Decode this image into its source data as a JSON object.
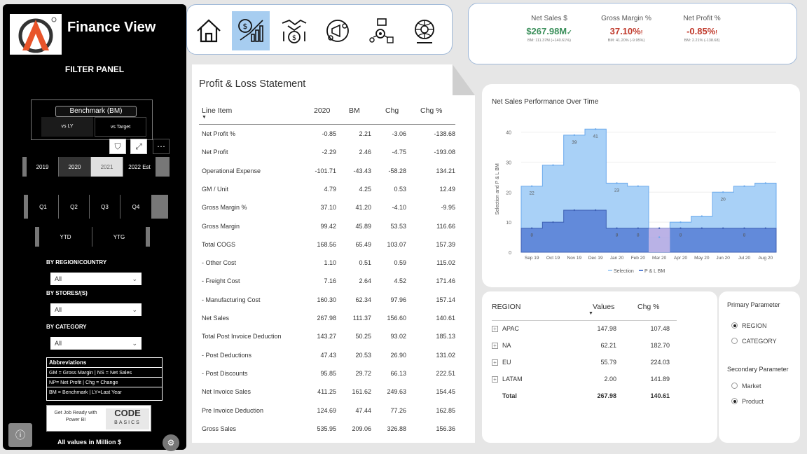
{
  "app": {
    "title": "Finance View"
  },
  "sidebar": {
    "filter_title": "FILTER PANEL",
    "benchmark": {
      "label": "Benchmark (BM)",
      "options": [
        "vs LY",
        "vs Target"
      ]
    },
    "years": [
      "2019",
      "2020",
      "2021",
      "2022 Est"
    ],
    "quarters": [
      "Q1",
      "Q2",
      "Q3",
      "Q4"
    ],
    "periods": [
      "YTD",
      "YTG"
    ],
    "region_label": "BY REGION/COUNTRY",
    "region_value": "All",
    "stores_label": "BY STORES/(S)",
    "stores_value": "All",
    "category_label": "BY CATEGORY",
    "category_value": "All",
    "abbreviations": {
      "title": "Abbreviations",
      "rows": [
        "GM = Gross Margin | NS = Net Sales",
        "NP= Net Profit | Chg = Change",
        "BM = Benchmark | LY=Last Year"
      ]
    },
    "promo": {
      "left": "Get Job Ready with Power BI",
      "brand": "CODE",
      "brand_sub": "BASICS"
    },
    "footer_note": "All values in Million $"
  },
  "kpis": [
    {
      "title": "Net Sales $",
      "value": "$267.98M",
      "mark": "✓",
      "sub": "BM: 111.37M (+140.61%)",
      "color": "#2e8b57"
    },
    {
      "title": "Gross Margin %",
      "value": "37.10%",
      "mark": "!",
      "sub": "BM: 41.20% (-9.95%)",
      "color": "#c0392b"
    },
    {
      "title": "Net Profit %",
      "value": "-0.85%",
      "mark": "!",
      "sub": "BM: 2.21% (-138.68)",
      "color": "#c0392b"
    }
  ],
  "pl": {
    "title": "Profit & Loss Statement",
    "columns": [
      "Line Item",
      "2020",
      "BM",
      "Chg",
      "Chg %"
    ],
    "rows": [
      [
        "Net Profit %",
        "-0.85",
        "2.21",
        "-3.06",
        "-138.68"
      ],
      [
        "Net Profit",
        "-2.29",
        "2.46",
        "-4.75",
        "-193.08"
      ],
      [
        "Operational Expense",
        "-101.71",
        "-43.43",
        "-58.28",
        "134.21"
      ],
      [
        "GM / Unit",
        "4.79",
        "4.25",
        "0.53",
        "12.49"
      ],
      [
        "Gross Margin %",
        "37.10",
        "41.20",
        "-4.10",
        "-9.95"
      ],
      [
        "Gross Margin",
        "99.42",
        "45.89",
        "53.53",
        "116.66"
      ],
      [
        "Total COGS",
        "168.56",
        "65.49",
        "103.07",
        "157.39"
      ],
      [
        " - Other Cost",
        "1.10",
        "0.51",
        "0.59",
        "115.02"
      ],
      [
        " - Freight Cost",
        "7.16",
        "2.64",
        "4.52",
        "171.46"
      ],
      [
        " - Manufacturing Cost",
        "160.30",
        "62.34",
        "97.96",
        "157.14"
      ],
      [
        "Net Sales",
        "267.98",
        "111.37",
        "156.60",
        "140.61"
      ],
      [
        "Total Post Invoice Deduction",
        "143.27",
        "50.25",
        "93.02",
        "185.13"
      ],
      [
        " - Post Deductions",
        "47.43",
        "20.53",
        "26.90",
        "131.02"
      ],
      [
        " - Post Discounts",
        "95.85",
        "29.72",
        "66.13",
        "222.51"
      ],
      [
        "Net Invoice Sales",
        "411.25",
        "161.62",
        "249.63",
        "154.45"
      ],
      [
        "Pre Invoice Deduction",
        "124.69",
        "47.44",
        "77.26",
        "162.85"
      ],
      [
        "Gross Sales",
        "535.95",
        "209.06",
        "326.88",
        "156.36"
      ]
    ]
  },
  "chart_data": {
    "type": "area",
    "title": "Net Sales Performance Over Time",
    "ylabel": "Selection and P & L BM",
    "xlabel": "",
    "categories": [
      "Sep 19",
      "Oct 19",
      "Nov 19",
      "Dec 19",
      "Jan 20",
      "Feb 20",
      "Mar 20",
      "Apr 20",
      "May 20",
      "Jun 20",
      "Jul 20",
      "Aug 20"
    ],
    "x_ticks": [
      "Sep 19",
      "Oct 19",
      "Nov 19",
      "Dec 19",
      "Jan 20",
      "Feb 20",
      "Mar 20",
      "Apr 20",
      "May 20",
      "Jun 20",
      "Jul 20",
      "Aug 20"
    ],
    "yticks": [
      0,
      10,
      20,
      30,
      40
    ],
    "ylim": [
      0,
      42
    ],
    "series": [
      {
        "name": "Selection",
        "values": [
          22,
          29,
          39,
          41,
          23,
          22,
          5,
          10,
          12,
          20,
          22,
          23
        ],
        "color": "#a9d1f7"
      },
      {
        "name": "P & L BM",
        "values": [
          8,
          10,
          14,
          14,
          8,
          8,
          8,
          8,
          8,
          8,
          8,
          8
        ],
        "color": "#5a82d6"
      }
    ],
    "data_labels_selection": [
      "22",
      "",
      "39",
      "41",
      "23",
      "",
      "",
      "",
      "",
      "20",
      "",
      ""
    ],
    "data_labels_bm": [
      "8",
      "",
      "",
      "",
      "8",
      "8",
      "",
      "8",
      "",
      "",
      "8",
      ""
    ],
    "legend_position": "bottom"
  },
  "region": {
    "columns": [
      "REGION",
      "Values",
      "Chg %"
    ],
    "rows": [
      [
        "APAC",
        "147.98",
        "107.48"
      ],
      [
        "NA",
        "62.21",
        "182.70"
      ],
      [
        "EU",
        "55.79",
        "224.03"
      ],
      [
        "LATAM",
        "2.00",
        "141.89"
      ]
    ],
    "total": [
      "Total",
      "267.98",
      "140.61"
    ]
  },
  "params": {
    "primary": {
      "label": "Primary Parameter",
      "options": [
        "REGION",
        "CATEGORY"
      ],
      "selected": "REGION"
    },
    "secondary": {
      "label": "Secondary Parameter",
      "options": [
        "Market",
        "Product"
      ],
      "selected": "Product"
    }
  }
}
